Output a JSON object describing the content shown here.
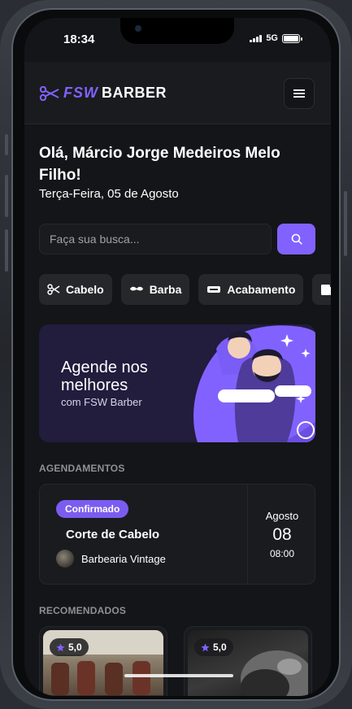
{
  "status_bar": {
    "time": "18:34",
    "network": "5G"
  },
  "header": {
    "logo_fsw": "FSW",
    "logo_barber": "BARBER"
  },
  "greeting": {
    "title": "Olá, Márcio Jorge Medeiros Melo Filho!",
    "date": "Terça-Feira, 05 de Agosto"
  },
  "search": {
    "placeholder": "Faça sua busca..."
  },
  "quick_search": [
    {
      "label": "Cabelo",
      "icon": "scissors-icon"
    },
    {
      "label": "Barba",
      "icon": "mustache-icon"
    },
    {
      "label": "Acabamento",
      "icon": "razor-icon"
    },
    {
      "label": "",
      "icon": "towel-icon"
    }
  ],
  "banner": {
    "title": "Agende nos melhores",
    "subtitle": "com FSW Barber"
  },
  "sections": {
    "bookings": "AGENDAMENTOS",
    "recommended": "RECOMENDADOS"
  },
  "booking": {
    "status": "Confirmado",
    "service": "Corte de Cabelo",
    "shop": "Barbearia Vintage",
    "month": "Agosto",
    "day": "08",
    "time": "08:00"
  },
  "recommended": [
    {
      "rating": "5,0"
    },
    {
      "rating": "5,0"
    }
  ],
  "colors": {
    "accent": "#8162ff",
    "background": "#141518",
    "card": "#1a1b1f"
  }
}
